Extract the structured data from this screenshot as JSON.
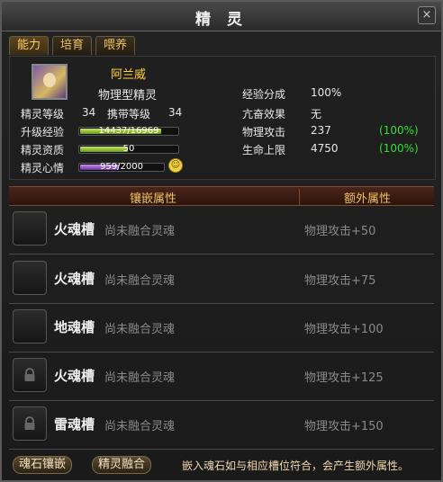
{
  "window": {
    "title": "精 灵",
    "close_label": "×"
  },
  "tabs": [
    "能力",
    "培育",
    "喂养"
  ],
  "sprite": {
    "name": "阿兰威",
    "type": "物理型精灵",
    "level_label": "精灵等级",
    "level": "34",
    "carry_label": "携带等级",
    "carry": "34",
    "exp_label": "升级经验",
    "exp_text": "14437/16969",
    "exp_fraction": 0.851,
    "quality_label": "精灵资质",
    "quality_text": "50",
    "quality_fraction": 0.5,
    "mood_label": "精灵心情",
    "mood_text": "959/2000",
    "mood_fraction": 0.48,
    "share_label": "经验分成",
    "share": "100%",
    "frenzy_label": "亢奋效果",
    "frenzy": "无",
    "atk_label": "物理攻击",
    "atk": "237",
    "atk_pct": "(100%)",
    "hp_label": "生命上限",
    "hp": "4750",
    "hp_pct": "(100%)"
  },
  "table": {
    "header_inlay": "镶嵌属性",
    "header_extra": "额外属性",
    "rows": [
      {
        "name": "火魂槽",
        "status": "尚未融合灵魂",
        "bonus": "物理攻击+50",
        "locked": false
      },
      {
        "name": "火魂槽",
        "status": "尚未融合灵魂",
        "bonus": "物理攻击+75",
        "locked": false
      },
      {
        "name": "地魂槽",
        "status": "尚未融合灵魂",
        "bonus": "物理攻击+100",
        "locked": false
      },
      {
        "name": "火魂槽",
        "status": "尚未融合灵魂",
        "bonus": "物理攻击+125",
        "locked": true
      },
      {
        "name": "雷魂槽",
        "status": "尚未融合灵魂",
        "bonus": "物理攻击+150",
        "locked": true
      }
    ]
  },
  "footer": {
    "inlay_button": "魂石镶嵌",
    "fuse_button": "精灵融合",
    "hint": "嵌入魂石如与相应槽位符合，会产生额外属性。"
  },
  "colors": {
    "accent": "#ffd040",
    "bonus_green": "#30e030",
    "header_red": "#4a2418"
  }
}
